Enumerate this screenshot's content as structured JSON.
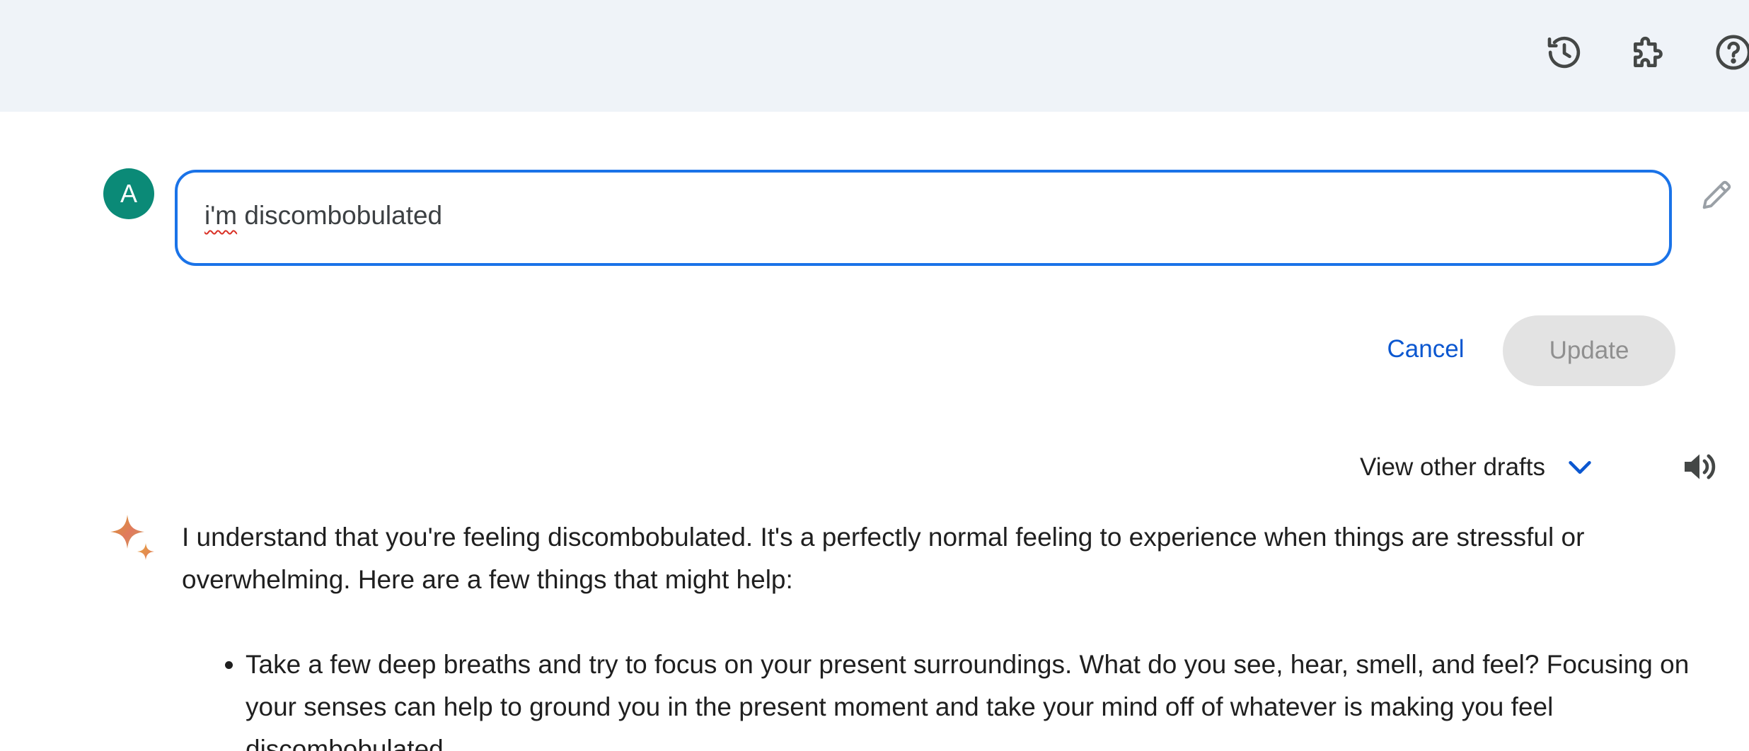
{
  "topbar": {
    "icons": [
      "history-icon",
      "extension-icon",
      "help-icon"
    ]
  },
  "user": {
    "avatar_initial": "A",
    "avatar_color": "#0b8a77"
  },
  "editor": {
    "prefix": "i'm",
    "rest": " discombobulated",
    "border_color": "#1a73e8"
  },
  "actions": {
    "cancel_label": "Cancel",
    "update_label": "Update"
  },
  "drafts": {
    "label": "View other drafts"
  },
  "response": {
    "intro": "I understand that you're feeling discombobulated. It's a perfectly normal feeling to experience when things are stressful or overwhelming. Here are a few things that might help:",
    "bullets": [
      "Take a few deep breaths and try to focus on your present surroundings. What do you see, hear, smell, and feel? Focusing on your senses can help to ground you in the present moment and take your mind off of whatever is making you feel discombobulated."
    ]
  },
  "colors": {
    "topbar_bg": "#eff3f8",
    "link_blue": "#0b57d0",
    "disabled_bg": "#e3e3e3"
  }
}
